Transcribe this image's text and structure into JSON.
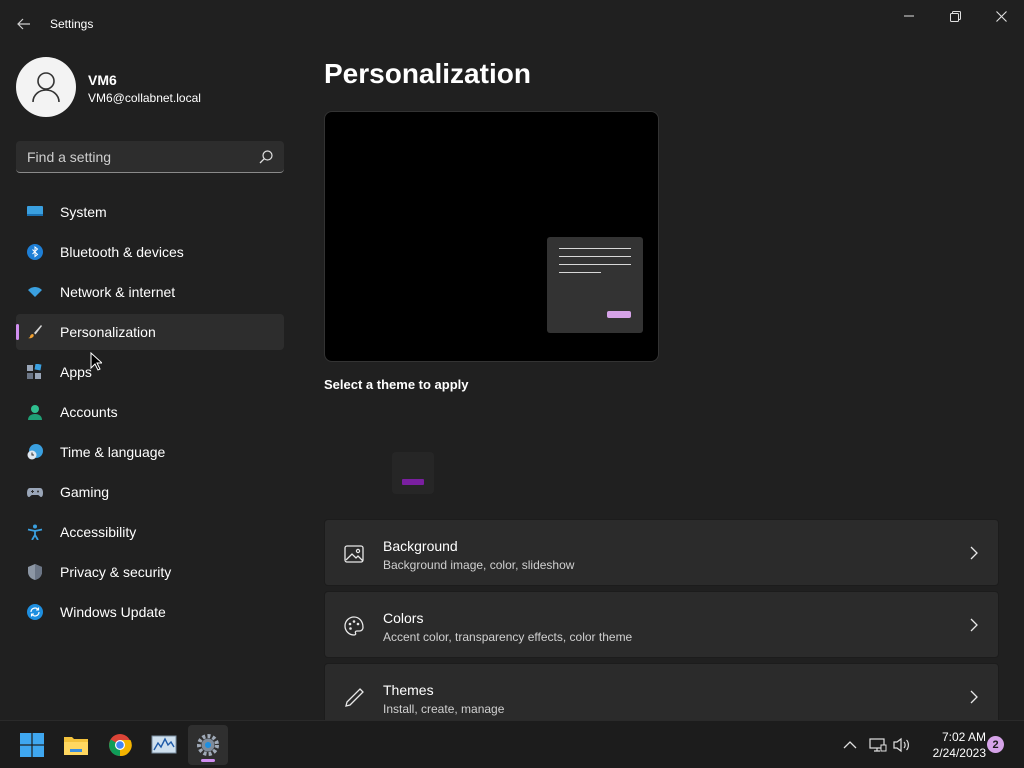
{
  "window": {
    "title": "Settings"
  },
  "profile": {
    "name": "VM6",
    "email": "VM6@collabnet.local"
  },
  "search": {
    "placeholder": "Find a setting"
  },
  "nav": {
    "items": [
      {
        "label": "System",
        "icon": "system-icon"
      },
      {
        "label": "Bluetooth & devices",
        "icon": "bluetooth-icon"
      },
      {
        "label": "Network & internet",
        "icon": "wifi-icon"
      },
      {
        "label": "Personalization",
        "icon": "brush-icon",
        "selected": true
      },
      {
        "label": "Apps",
        "icon": "apps-icon"
      },
      {
        "label": "Accounts",
        "icon": "account-icon"
      },
      {
        "label": "Time & language",
        "icon": "clock-globe-icon"
      },
      {
        "label": "Gaming",
        "icon": "gamepad-icon"
      },
      {
        "label": "Accessibility",
        "icon": "accessibility-icon"
      },
      {
        "label": "Privacy & security",
        "icon": "shield-icon"
      },
      {
        "label": "Windows Update",
        "icon": "update-icon"
      }
    ]
  },
  "main": {
    "title": "Personalization",
    "theme_label": "Select a theme to apply",
    "cards": [
      {
        "title": "Background",
        "subtitle": "Background image, color, slideshow",
        "icon": "image-icon"
      },
      {
        "title": "Colors",
        "subtitle": "Accent color, transparency effects, color theme",
        "icon": "palette-icon"
      },
      {
        "title": "Themes",
        "subtitle": "Install, create, manage",
        "icon": "pen-icon"
      }
    ]
  },
  "taskbar": {
    "time": "7:02 AM",
    "date": "2/24/2023",
    "notification_count": "2"
  },
  "colors": {
    "accent": "#d08ef0",
    "background": "#202020",
    "card": "#2b2b2b"
  }
}
